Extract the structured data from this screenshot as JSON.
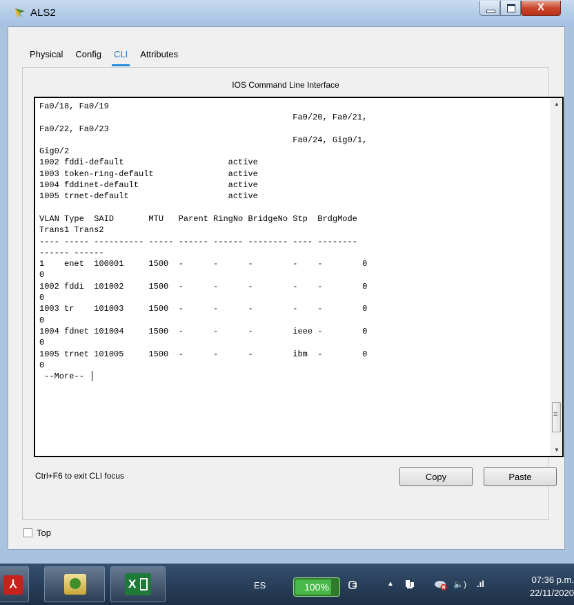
{
  "window": {
    "title": "ALS2",
    "close_glyph": "X"
  },
  "tabs": [
    {
      "label": "Physical",
      "active": false
    },
    {
      "label": "Config",
      "active": false
    },
    {
      "label": "CLI",
      "active": true
    },
    {
      "label": "Attributes",
      "active": false
    }
  ],
  "cli": {
    "heading": "IOS Command Line Interface",
    "output": "Fa0/18, Fa0/19\n                                                   Fa0/20, Fa0/21,\nFa0/22, Fa0/23\n                                                   Fa0/24, Gig0/1,\nGig0/2\n1002 fddi-default                     active\n1003 token-ring-default               active\n1004 fddinet-default                  active\n1005 trnet-default                    active\n\nVLAN Type  SAID       MTU   Parent RingNo BridgeNo Stp  BrdgMode\nTrans1 Trans2\n---- ----- ---------- ----- ------ ------ -------- ---- --------\n------ ------\n1    enet  100001     1500  -      -      -        -    -        0\n0\n1002 fddi  101002     1500  -      -      -        -    -        0\n0\n1003 tr    101003     1500  -      -      -        -    -        0\n0\n1004 fdnet 101004     1500  -      -      -        ieee -        0\n0\n1005 trnet 101005     1500  -      -      -        ibm  -        0\n0",
    "prompt": " --More-- ",
    "exit_hint": "Ctrl+F6 to exit CLI focus",
    "copy_label": "Copy",
    "paste_label": "Paste",
    "scroll_up_glyph": "▲",
    "scroll_down_glyph": "▼"
  },
  "top_checkbox": {
    "label": "Top",
    "checked": false
  },
  "taskbar": {
    "pdf_glyph": "⅄",
    "excel_glyph": "X",
    "language": "ES",
    "battery": "100%",
    "clock_time": "07:36 p.m.",
    "clock_date": "22/11/2020",
    "tray_arrow": "▲",
    "tray_volume": "🔈)",
    "tray_signal": ".ıl"
  }
}
